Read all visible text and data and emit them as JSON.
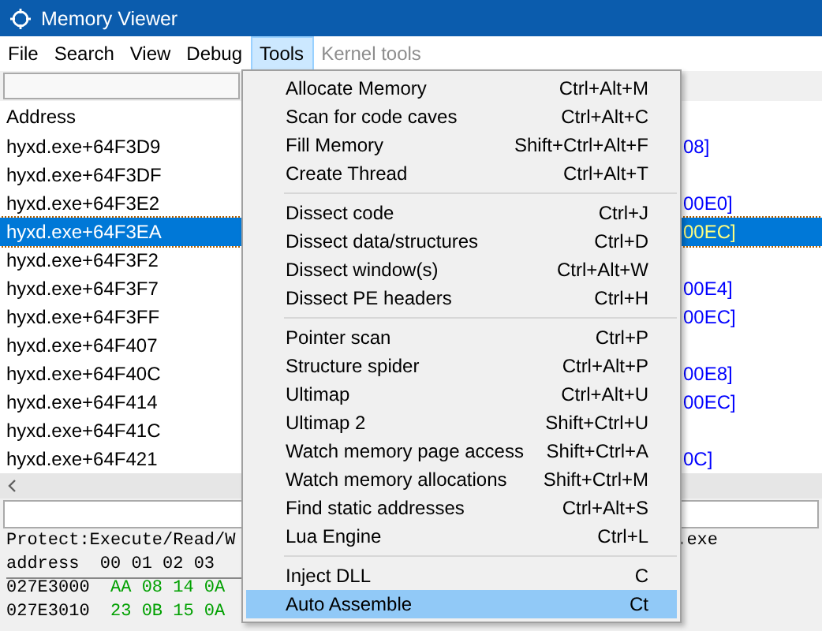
{
  "window": {
    "title": "Memory Viewer"
  },
  "menubar": [
    {
      "label": "File",
      "selected": false,
      "disabled": false
    },
    {
      "label": "Search",
      "selected": false,
      "disabled": false
    },
    {
      "label": "View",
      "selected": false,
      "disabled": false
    },
    {
      "label": "Debug",
      "selected": false,
      "disabled": false
    },
    {
      "label": "Tools",
      "selected": true,
      "disabled": false
    },
    {
      "label": "Kernel tools",
      "selected": false,
      "disabled": true
    }
  ],
  "disassembly": {
    "columns": [
      "Address"
    ],
    "rows": [
      {
        "address": "hyxd.exe+64F3D9",
        "column_2": "08]",
        "selected": false
      },
      {
        "address": "hyxd.exe+64F3DF",
        "selected": false
      },
      {
        "address": "hyxd.exe+64F3E2",
        "column_2": "00E0]",
        "selected": false
      },
      {
        "address": "hyxd.exe+64F3EA",
        "column_2": "00EC]",
        "selected": true
      },
      {
        "address": "hyxd.exe+64F3F2",
        "selected": false
      },
      {
        "address": "hyxd.exe+64F3F7",
        "column_2": "00E4]",
        "selected": false
      },
      {
        "address": "hyxd.exe+64F3FF",
        "column_2": "00EC]",
        "selected": false
      },
      {
        "address": "hyxd.exe+64F407",
        "selected": false
      },
      {
        "address": "hyxd.exe+64F40C",
        "column_2": "00E8]",
        "selected": false
      },
      {
        "address": "hyxd.exe+64F414",
        "column_2": "00EC]",
        "selected": false
      },
      {
        "address": "hyxd.exe+64F41C",
        "selected": false
      },
      {
        "address": "hyxd.exe+64F421",
        "column_2": "0C]",
        "selected": false
      }
    ]
  },
  "hex_view": {
    "protection": "Protect:Execute/Read/W",
    "module": ".exe",
    "header": "address  00 01 02 03",
    "rows": [
      {
        "address": "027E3000",
        "bytes": "AA 08 14 0A"
      },
      {
        "address": "027E3010",
        "bytes": "23 0B 15 0A"
      }
    ]
  },
  "menu": {
    "items": [
      {
        "kind": "item",
        "label": "Allocate Memory",
        "shortcut": "Ctrl+Alt+M",
        "selected": false
      },
      {
        "kind": "item",
        "label": "Scan for code caves",
        "shortcut": "Ctrl+Alt+C",
        "selected": false
      },
      {
        "kind": "item",
        "label": "Fill Memory",
        "shortcut": "Shift+Ctrl+Alt+F",
        "selected": false
      },
      {
        "kind": "item",
        "label": "Create Thread",
        "shortcut": "Ctrl+Alt+T",
        "selected": false
      },
      {
        "kind": "separator"
      },
      {
        "kind": "item",
        "label": "Dissect code",
        "shortcut": "Ctrl+J",
        "selected": false
      },
      {
        "kind": "item",
        "label": "Dissect data/structures",
        "shortcut": "Ctrl+D",
        "selected": false
      },
      {
        "kind": "item",
        "label": "Dissect window(s)",
        "shortcut": "Ctrl+Alt+W",
        "selected": false
      },
      {
        "kind": "item",
        "label": "Dissect PE headers",
        "shortcut": "Ctrl+H",
        "selected": false
      },
      {
        "kind": "separator"
      },
      {
        "kind": "item",
        "label": "Pointer scan",
        "shortcut": "Ctrl+P",
        "selected": false
      },
      {
        "kind": "item",
        "label": "Structure spider",
        "shortcut": "Ctrl+Alt+P",
        "selected": false
      },
      {
        "kind": "item",
        "label": "Ultimap",
        "shortcut": "Ctrl+Alt+U",
        "selected": false
      },
      {
        "kind": "item",
        "label": "Ultimap 2",
        "shortcut": "Shift+Ctrl+U",
        "selected": false
      },
      {
        "kind": "item",
        "label": "Watch memory page access",
        "shortcut": "Shift+Ctrl+A",
        "selected": false
      },
      {
        "kind": "item",
        "label": "Watch memory allocations",
        "shortcut": "Shift+Ctrl+M",
        "selected": false
      },
      {
        "kind": "item",
        "label": "Find static addresses",
        "shortcut": "Ctrl+Alt+S",
        "selected": false
      },
      {
        "kind": "item",
        "label": "Lua Engine",
        "shortcut": "Ctrl+L",
        "selected": false
      },
      {
        "kind": "separator"
      },
      {
        "kind": "item",
        "label": "Inject DLL",
        "shortcut": "C",
        "selected": false
      },
      {
        "kind": "item",
        "label": "Auto Assemble",
        "shortcut": "Ct",
        "selected": true
      }
    ]
  }
}
